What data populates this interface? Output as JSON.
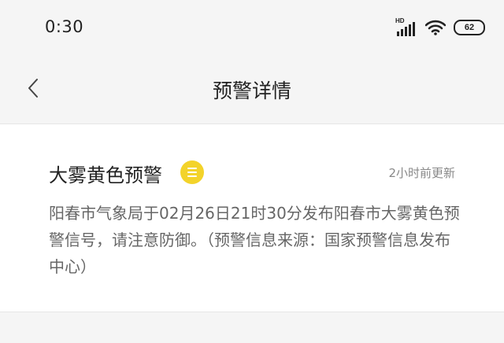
{
  "status_bar": {
    "time": "0:30",
    "signal_label": "HD",
    "battery_level": "62",
    "icons": [
      "signal-icon",
      "wifi-icon",
      "battery-icon"
    ]
  },
  "header": {
    "title": "预警详情",
    "back_icon": "chevron-left-icon"
  },
  "warning": {
    "title": "大雾黄色预警",
    "badge_color": "#f3d32a",
    "badge_icon": "warning-level-icon",
    "update_time": "2小时前更新",
    "body": "阳春市气象局于02月26日21时30分发布阳春市大雾黄色预警信号，请注意防御。（预警信息来源：国家预警信息发布中心）"
  }
}
